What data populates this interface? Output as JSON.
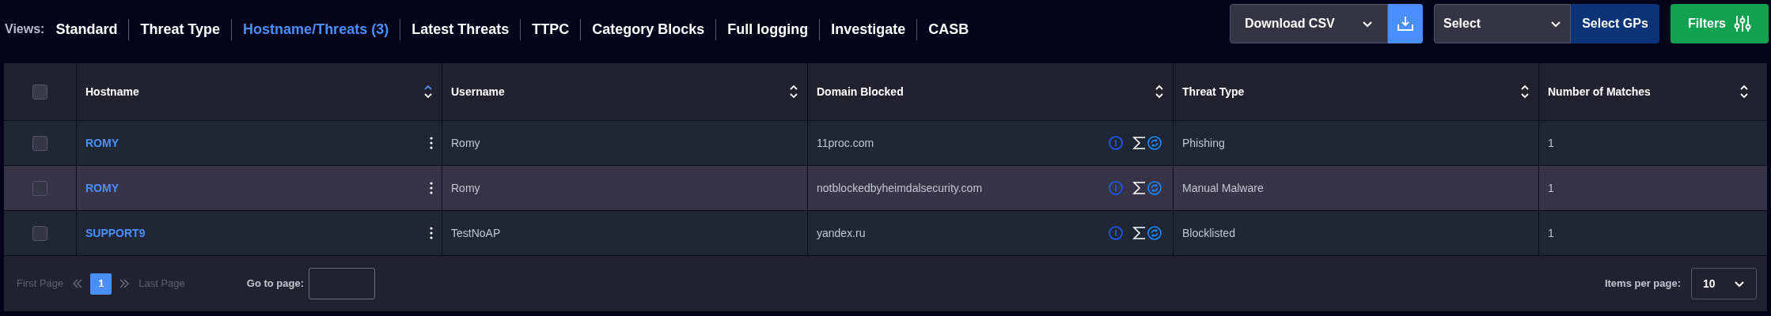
{
  "views": {
    "label": "Views:",
    "items": [
      {
        "label": "Standard",
        "selected": false
      },
      {
        "label": "Threat Type",
        "selected": false
      },
      {
        "label": "Hostname/Threats (3)",
        "selected": true
      },
      {
        "label": "Latest Threats",
        "selected": false
      },
      {
        "label": "TTPC",
        "selected": false
      },
      {
        "label": "Category Blocks",
        "selected": false
      },
      {
        "label": "Full logging",
        "selected": false
      },
      {
        "label": "Investigate",
        "selected": false
      },
      {
        "label": "CASB",
        "selected": false
      }
    ]
  },
  "toolbar": {
    "download": {
      "value": "Download CSV"
    },
    "select": {
      "value": "Select",
      "button": "Select GPs"
    },
    "filters": "Filters"
  },
  "table": {
    "select_all": {
      "checked": false
    },
    "columns": [
      {
        "label": "Hostname",
        "sorted": true
      },
      {
        "label": "Username",
        "sorted": false
      },
      {
        "label": "Domain Blocked",
        "sorted": false
      },
      {
        "label": "Threat Type",
        "sorted": false
      },
      {
        "label": "Number of Matches",
        "sorted": false
      }
    ],
    "rows": [
      {
        "checked": false,
        "highlighted": false,
        "hostname": "ROMY",
        "username": "Romy",
        "domain": "11proc.com",
        "threat_type": "Phishing",
        "matches": "1"
      },
      {
        "checked": false,
        "highlighted": true,
        "hostname": "ROMY",
        "username": "Romy",
        "domain": "notblockedbyheimdalsecurity.com",
        "threat_type": "Manual Malware",
        "matches": "1"
      },
      {
        "checked": false,
        "highlighted": false,
        "hostname": "SUPPORT9",
        "username": "TestNoAP",
        "domain": "yandex.ru",
        "threat_type": "Blocklisted",
        "matches": "1"
      }
    ]
  },
  "pagination": {
    "first": {
      "label": "First Page",
      "disabled": true
    },
    "pages": [
      {
        "label": "1",
        "selected": true
      }
    ],
    "last": {
      "label": "Last Page",
      "disabled": true
    },
    "goto_label": "Go to page:",
    "items_label": "Items per page:",
    "items_value": "10"
  }
}
